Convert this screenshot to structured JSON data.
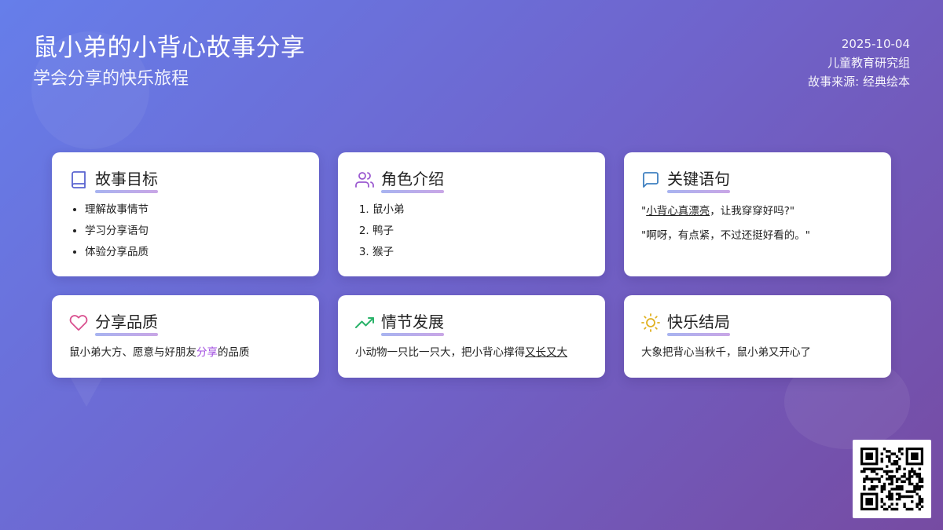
{
  "header": {
    "title": "鼠小弟的小背心故事分享",
    "subtitle": "学会分享的快乐旅程",
    "date": "2025-10-04",
    "group": "儿童教育研究组",
    "source": "故事来源: 经典绘本"
  },
  "cards": {
    "goals": {
      "title": "故事目标",
      "icon": "book-icon",
      "items": [
        "理解故事情节",
        "学习分享语句",
        "体验分享品质"
      ]
    },
    "roles": {
      "title": "角色介绍",
      "icon": "users-icon",
      "items": [
        "鼠小弟",
        "鸭子",
        "猴子"
      ]
    },
    "phrases": {
      "title": "关键语句",
      "icon": "chat-bubble-icon",
      "q1_open": "\"",
      "q1_u": "小背心真漂亮",
      "q1_rest": "，让我穿穿好吗?\"",
      "q2": "\"啊呀，有点紧，不过还挺好看的。\""
    },
    "quality": {
      "title": "分享品质",
      "icon": "heart-icon",
      "text_a": "鼠小弟大方、愿意与好朋友",
      "text_accent": "分享",
      "text_b": "的品质"
    },
    "plot": {
      "title": "情节发展",
      "icon": "trend-up-icon",
      "text_a": "小动物一只比一只大，把小背心撑得",
      "text_u": "又长又大"
    },
    "ending": {
      "title": "快乐结局",
      "icon": "sun-icon",
      "text": "大象把背心当秋千，鼠小弟又开心了"
    }
  },
  "colors": {
    "bg_start": "#667eea",
    "bg_end": "#764ba2",
    "accent": "#a24fe0",
    "underline": "#b9aeea"
  },
  "qr": {
    "icon": "qr-code"
  }
}
